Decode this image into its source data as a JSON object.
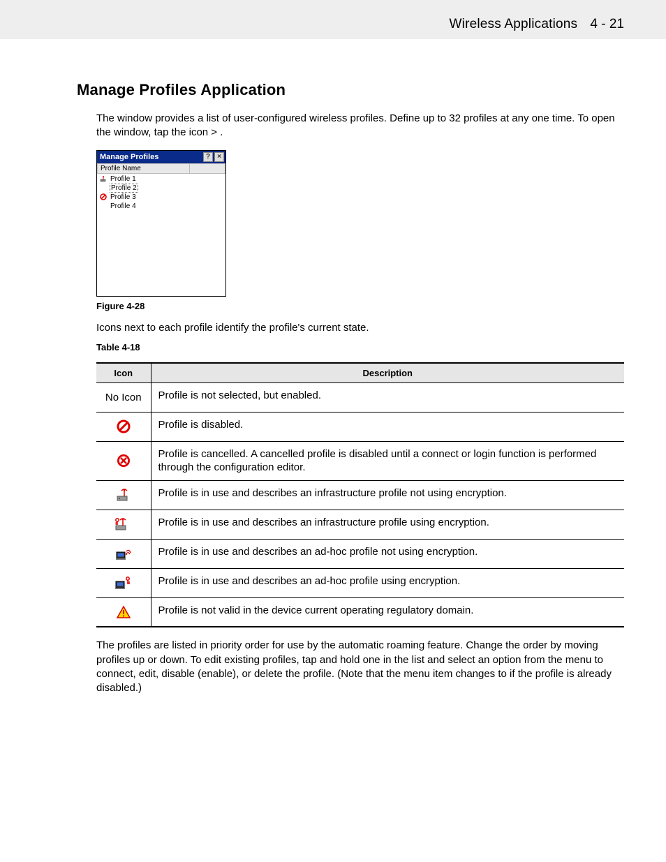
{
  "header": {
    "title": "Wireless Applications",
    "pageno": "4 - 21"
  },
  "section_heading": "Manage Profiles Application",
  "intro": {
    "p1a": "The ",
    "p1b": " window provides a list of user-configured wireless profiles. Define up to 32 profiles at any one time. To open the ",
    "p1c": " window, tap the ",
    "p1d": " icon > ",
    "p1e": "."
  },
  "screenshot": {
    "title": "Manage Profiles",
    "col": "Profile Name",
    "rows": [
      "Profile 1",
      "Profile 2",
      "Profile 3",
      "Profile 4"
    ]
  },
  "figure_label": "Figure 4-28",
  "mid_para": "Icons next to each profile identify the profile's current state.",
  "table_label": "Table 4-18",
  "table": {
    "head_icon": "Icon",
    "head_desc": "Description",
    "rows": [
      {
        "icon_label": "No Icon",
        "icon": "none",
        "desc": "Profile is not selected, but enabled."
      },
      {
        "icon_label": "",
        "icon": "disabled",
        "desc": "Profile is disabled."
      },
      {
        "icon_label": "",
        "icon": "cancelled",
        "desc": "Profile is cancelled. A cancelled profile is disabled until a connect or login function is performed through the configuration editor."
      },
      {
        "icon_label": "",
        "icon": "infra-noenc",
        "desc": "Profile is in use and describes an infrastructure profile not using encryption."
      },
      {
        "icon_label": "",
        "icon": "infra-enc",
        "desc": "Profile is in use and describes an infrastructure profile using encryption."
      },
      {
        "icon_label": "",
        "icon": "adhoc-noenc",
        "desc": "Profile is in use and describes an ad-hoc profile not using encryption."
      },
      {
        "icon_label": "",
        "icon": "adhoc-enc",
        "desc": "Profile is in use and describes an ad-hoc profile using encryption."
      },
      {
        "icon_label": "",
        "icon": "warning",
        "desc": "Profile is not valid in the device current operating regulatory domain."
      }
    ]
  },
  "end_para": {
    "a": "The profiles are listed in priority order for use by the automatic roaming feature. Change the order by moving profiles up or down. To edit existing profiles, tap and hold one in the list and select an option from the menu to connect, edit, disable (enable), or delete the profile. (Note that the ",
    "b": " menu item changes to ",
    "c": " if the profile is already disabled.)"
  }
}
